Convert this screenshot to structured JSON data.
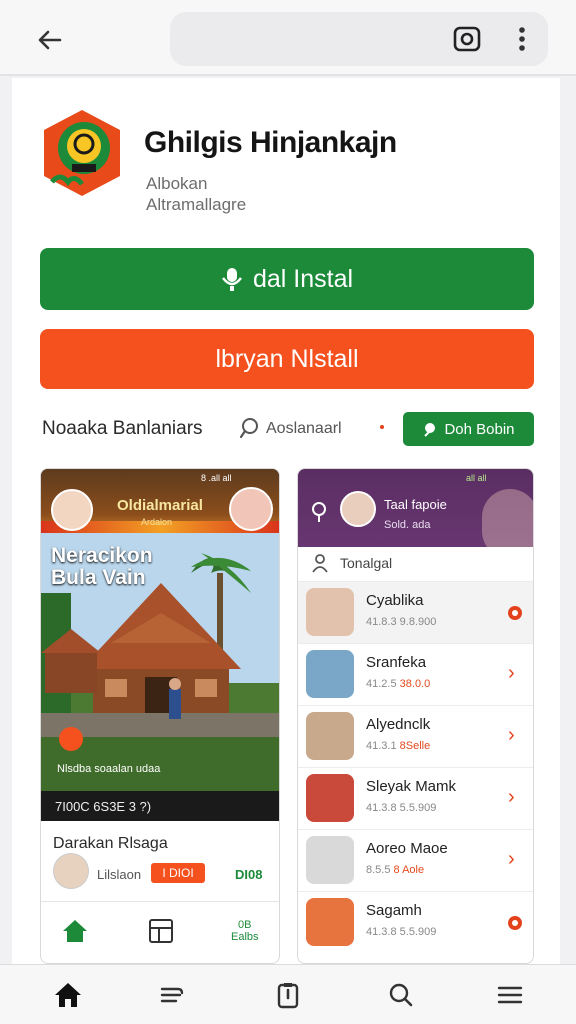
{
  "browser": {
    "back_icon": "arrow-left-icon",
    "camera_icon": "camera-icon",
    "menu_icon": "more-vertical-icon"
  },
  "app": {
    "name": "Ghilgis Hinjankajn",
    "subtitle_line1": "Albokan",
    "subtitle_line2": "Altramallagre",
    "logo_icon": "app-logo-icon"
  },
  "buttons": {
    "install_label": "dal Instal",
    "install_icon": "mic-icon",
    "uninstall_label": "lbryan Nlstall",
    "small_label": "Doh Bobin",
    "small_icon": "leaf-icon"
  },
  "info_row": {
    "label": "Noaaka Banlaniars",
    "search_label": "Aoslanaarl"
  },
  "left_card": {
    "status": "8 .all all",
    "hero_title": "Oldialmarial",
    "hero_subtitle": "Ardalon",
    "caption_line1": "Neracikon",
    "caption_line2": "Bula Vain",
    "strip_text": "Nlsdba soaalan udaa",
    "footer_text": "7I00C 6S3E 3 ?)",
    "section_title": "Darakan Rlsaga",
    "author_label": "Lilslaon",
    "tag_label": "I DIOI",
    "green_label": "DI08",
    "nav_right_label_line1": "0B",
    "nav_right_label_line2": "Ealbs"
  },
  "right_card": {
    "status": "all all",
    "header_name": "Taal fapoie",
    "header_meta": "Sold. ada",
    "sub_label": "Tonalgal",
    "items": [
      {
        "name": "Cyablika",
        "meta": "41.8.3 9.8.900",
        "marker": "dot",
        "selected": true
      },
      {
        "name": "Sranfeka",
        "meta": "41.2.5",
        "meta_accent": "38.0.0",
        "marker": "arrow",
        "selected": false
      },
      {
        "name": "Alyednclk",
        "meta": "41.3.1",
        "meta_accent": "8Selle",
        "marker": "arrow",
        "selected": false
      },
      {
        "name": "Sleyak Mamk",
        "meta": "41.3.8 5.5.909",
        "marker": "arrow",
        "selected": false
      },
      {
        "name": "Aoreo Maoe",
        "meta": "8.5.5",
        "meta_accent": "8 Aole",
        "marker": "arrow",
        "selected": false
      },
      {
        "name": "Sagamh",
        "meta": "41.3.8 5.5.909",
        "marker": "dot",
        "selected": false
      }
    ]
  },
  "bottom_nav": [
    {
      "name": "home",
      "icon": "home-icon",
      "active": true
    },
    {
      "name": "feed",
      "icon": "feed-icon",
      "active": false
    },
    {
      "name": "clipboard",
      "icon": "clipboard-icon",
      "active": false
    },
    {
      "name": "search",
      "icon": "search-icon",
      "active": false
    },
    {
      "name": "menu",
      "icon": "hamburger-icon",
      "active": false
    }
  ],
  "colors": {
    "green": "#1d8a3a",
    "orange": "#f4511e",
    "purple": "#5a2e63",
    "accent_red": "#e2431c"
  }
}
